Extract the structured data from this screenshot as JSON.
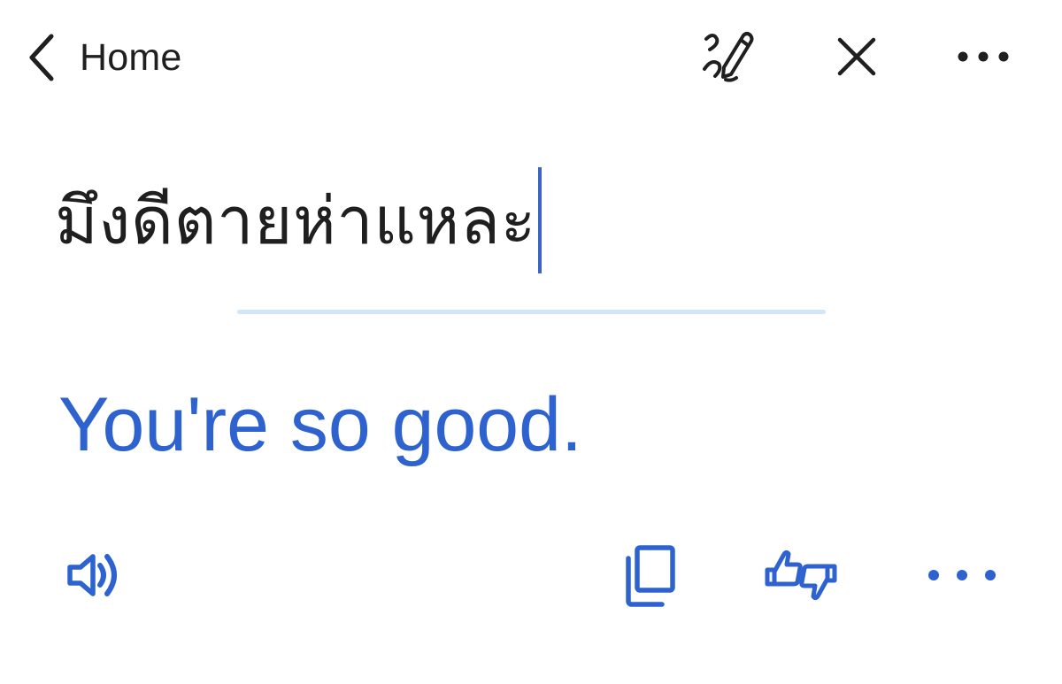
{
  "header": {
    "back_label": "Home",
    "icons": {
      "back": "chevron-left-icon",
      "handwrite": "handwriting-icon",
      "close": "close-icon",
      "more": "more-horizontal-icon"
    }
  },
  "source": {
    "text": "มึงดีตายห่าแหละ"
  },
  "translation": {
    "text": "You're so good."
  },
  "actions": {
    "icons": {
      "speak": "volume-icon",
      "copy": "copy-icon",
      "feedback": "thumbs-feedback-icon",
      "more": "more-horizontal-icon"
    }
  },
  "colors": {
    "text_primary": "#1f1f1f",
    "accent_blue": "#2d62cf",
    "cursor_blue": "#3c63c6",
    "divider": "#d3e6f8",
    "background": "#ffffff"
  }
}
